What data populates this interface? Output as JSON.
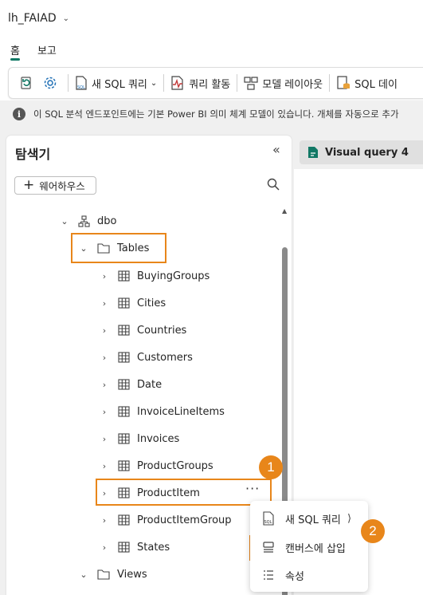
{
  "app": {
    "title": "lh_FAIAD"
  },
  "tabs": [
    {
      "label": "홈"
    },
    {
      "label": "보고"
    }
  ],
  "toolbar": {
    "new_sql_query": "새 SQL 쿼리",
    "query_activity": "쿼리 활동",
    "model_layout": "모델 레이아웃",
    "sql_db": "SQL 데이"
  },
  "infobar": {
    "text": "이 SQL 분석 엔드포인트에는 기본 Power BI 의미 체계 모델이 있습니다. 개체를 자동으로 추가"
  },
  "explorer": {
    "title": "탐색기",
    "add_warehouse": "웨어하우스",
    "schema": "dbo",
    "tables_folder": "Tables",
    "tables": [
      "BuyingGroups",
      "Cities",
      "Countries",
      "Customers",
      "Date",
      "InvoiceLineItems",
      "Invoices",
      "ProductGroups",
      "ProductItem",
      "ProductItemGroup",
      "States"
    ],
    "views_folder": "Views",
    "more": "···"
  },
  "query_tab": {
    "label": "Visual query 4"
  },
  "context_menu": {
    "items": [
      {
        "label": "새 SQL 쿼리",
        "icon": "sql-query-icon"
      },
      {
        "label": "캔버스에 삽입",
        "icon": "insert-canvas-icon"
      },
      {
        "label": "속성",
        "icon": "properties-icon"
      }
    ]
  },
  "badges": [
    "1",
    "2"
  ],
  "colors": {
    "accent": "#117865",
    "highlight": "#e8861a"
  }
}
